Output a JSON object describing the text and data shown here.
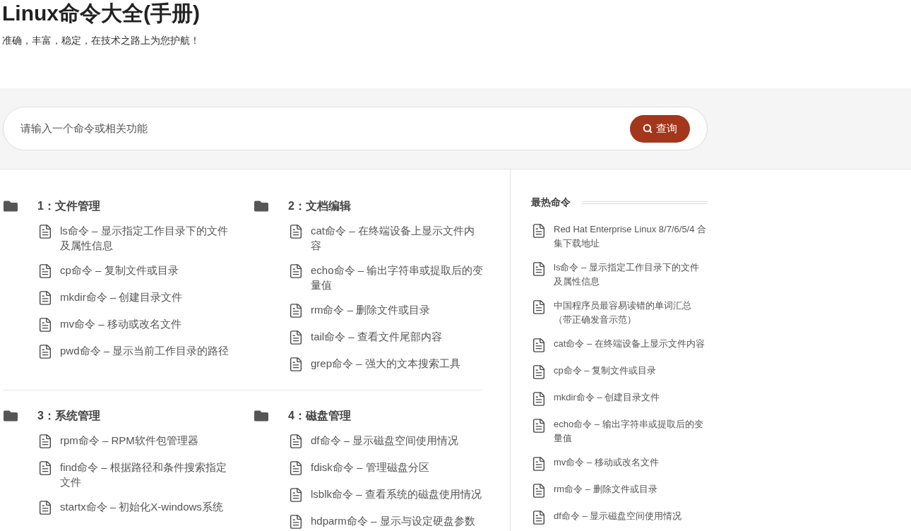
{
  "header": {
    "title": "Linux命令大全(手册)",
    "tagline": "准确，丰富，稳定，在技术之路上为您护航！"
  },
  "search": {
    "placeholder": "请输入一个命令或相关功能",
    "button": "查询"
  },
  "categories": [
    {
      "title": "1：文件管理",
      "items": [
        "ls命令 – 显示指定工作目录下的文件及属性信息",
        "cp命令 – 复制文件或目录",
        "mkdir命令 – 创建目录文件",
        "mv命令 – 移动或改名文件",
        "pwd命令 – 显示当前工作目录的路径"
      ]
    },
    {
      "title": "2：文档编辑",
      "items": [
        "cat命令 – 在终端设备上显示文件内容",
        "echo命令 – 输出字符串或提取后的变量值",
        "rm命令 – 删除文件或目录",
        "tail命令 – 查看文件尾部内容",
        "grep命令 – 强大的文本搜索工具"
      ]
    },
    {
      "title": "3：系统管理",
      "items": [
        "rpm命令 – RPM软件包管理器",
        "find命令 – 根据路径和条件搜索指定文件",
        "startx命令 – 初始化X-windows系统"
      ]
    },
    {
      "title": "4：磁盘管理",
      "items": [
        "df命令 – 显示磁盘空间使用情况",
        "fdisk命令 – 管理磁盘分区",
        "lsblk命令 – 查看系统的磁盘使用情况",
        "hdparm命令 – 显示与设定硬盘参数"
      ]
    }
  ],
  "sidebar": {
    "title": "最热命令",
    "items": [
      "Red Hat Enterprise Linux 8/7/6/5/4 合集下载地址",
      "ls命令 – 显示指定工作目录下的文件及属性信息",
      "中国程序员最容易读错的单词汇总（带正确发音示范）",
      "cat命令 – 在终端设备上显示文件内容",
      "cp命令 – 复制文件或目录",
      "mkdir命令 – 创建目录文件",
      "echo命令 – 输出字符串或提取后的变量值",
      "mv命令 – 移动或改名文件",
      "rm命令 – 删除文件或目录",
      "df命令 – 显示磁盘空间使用情况"
    ]
  }
}
